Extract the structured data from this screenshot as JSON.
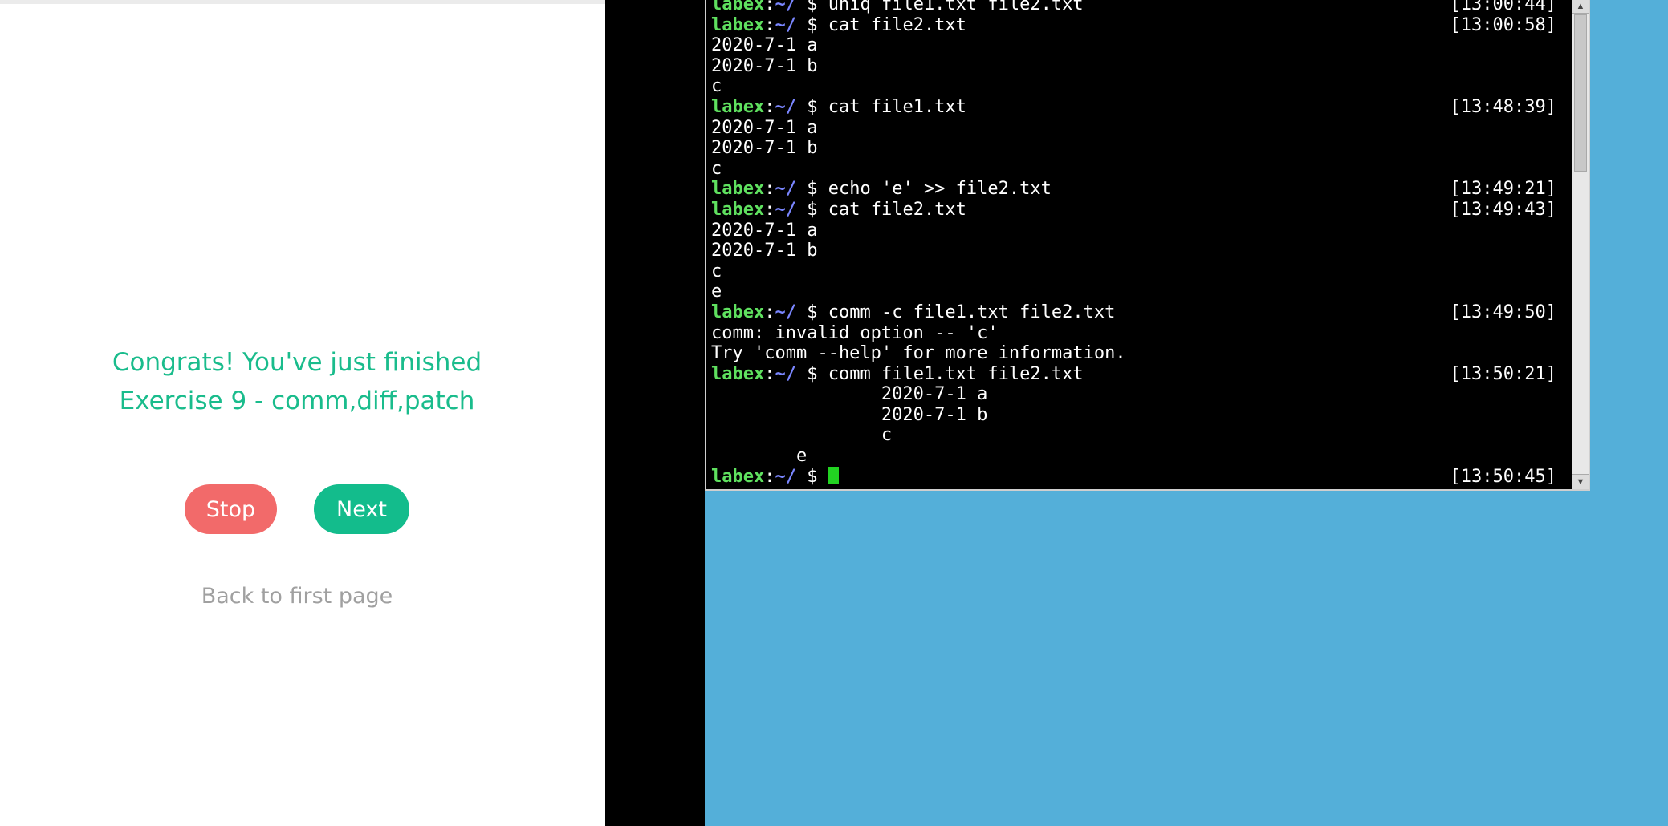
{
  "lab": {
    "congrats_line1": "Congrats! You've just finished",
    "congrats_line2": "Exercise 9 - comm,diff,patch",
    "stop_label": "Stop",
    "next_label": "Next",
    "back_label": "Back to first page"
  },
  "terminal": {
    "user": "labex",
    "path": "~/",
    "prompt_symbol": "$",
    "lines": [
      {
        "cmd": "uniq file1.txt file2.txt",
        "ts": "[13:00:44]"
      },
      {
        "cmd": "cat file2.txt",
        "ts": "[13:00:58]"
      },
      {
        "out": "2020-7-1 a"
      },
      {
        "out": "2020-7-1 b"
      },
      {
        "out": "c"
      },
      {
        "cmd": "cat file1.txt",
        "ts": "[13:48:39]"
      },
      {
        "out": "2020-7-1 a"
      },
      {
        "out": "2020-7-1 b"
      },
      {
        "out": "c"
      },
      {
        "cmd": "echo 'e' >> file2.txt",
        "ts": "[13:49:21]"
      },
      {
        "cmd": "cat file2.txt",
        "ts": "[13:49:43]"
      },
      {
        "out": "2020-7-1 a"
      },
      {
        "out": "2020-7-1 b"
      },
      {
        "out": "c"
      },
      {
        "out": "e"
      },
      {
        "cmd": "comm -c file1.txt file2.txt",
        "ts": "[13:49:50]"
      },
      {
        "out": "comm: invalid option -- 'c'"
      },
      {
        "out": "Try 'comm --help' for more information."
      },
      {
        "cmd": "comm file1.txt file2.txt",
        "ts": "[13:50:21]"
      },
      {
        "out": "                2020-7-1 a"
      },
      {
        "out": "                2020-7-1 b"
      },
      {
        "out": "                c"
      },
      {
        "out": "        e"
      },
      {
        "cmd": "",
        "ts": "[13:50:45]",
        "cursor": true
      }
    ]
  }
}
